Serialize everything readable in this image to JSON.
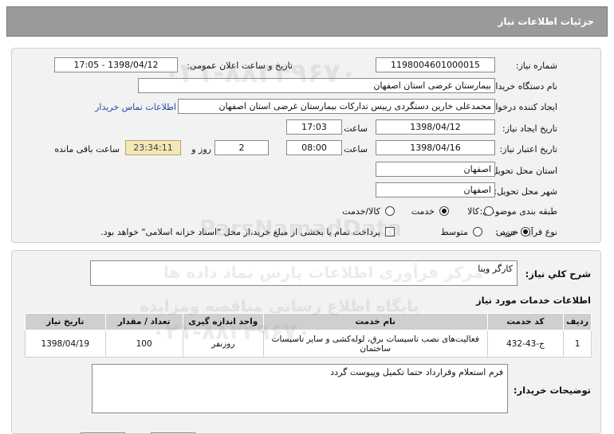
{
  "header": {
    "title": "جزئیات اطلاعات نیاز"
  },
  "fields": {
    "need_number_label": "شماره نیاز:",
    "need_number": "1198004601000015",
    "announce_label": "تاریخ و ساعت اعلان عمومی:",
    "announce_value": "1398/04/12 - 17:05",
    "buyer_org_label": "نام دستگاه خریدار:",
    "buyer_org": "بیمارستان غرضی استان اصفهان",
    "requester_label": "ایجاد کننده درخواست:",
    "requester": "محمدعلی خارین دستگردی رییس تدارکات بیمارستان غرضی استان اصفهان",
    "contact_link": "اطلاعات تماس خریدار",
    "created_label": "تاریخ ایجاد نیاز:",
    "created_date": "1398/04/12",
    "time_label": "ساعت",
    "created_time": "17:03",
    "valid_label": "تاریخ اعتبار نیاز:",
    "valid_date": "1398/04/16",
    "valid_time": "08:00",
    "days": "2",
    "days_label": "روز و",
    "remaining_time": "23:34:11",
    "remaining_label": "ساعت باقی مانده",
    "province_label": "استان محل تحویل:",
    "province": "اصفهان",
    "city_label": "شهر محل تحویل:",
    "city": "اصفهان",
    "category_label": "طبقه بندی موضوعی:",
    "category_options": [
      "کالا",
      "خدمت",
      "کالا/خدمت"
    ],
    "process_label": "نوع فرآیند خرید :",
    "process_options": [
      "جزیی",
      "متوسط"
    ],
    "payment_note": "پرداخت تمام یا بخشی از مبلغ خرید،از محل \"اسناد خزانه اسلامی\" خواهد بود."
  },
  "need_desc": {
    "label": "شرح کلي نیاز:",
    "value": "کارگر وینا"
  },
  "services": {
    "title": "اطلاعات خدمات مورد نیاز",
    "columns": [
      "ردیف",
      "کد خدمت",
      "نام خدمت",
      "واحد اندازه گیری",
      "تعداد / مقدار",
      "تاریخ نیاز"
    ],
    "rows": [
      [
        "1",
        "ج-43-432",
        "فعالیت‌های نصب تاسیسات برق، لوله‌کشی و سایر تاسیسات ساختمان",
        "روزنفر",
        "100",
        "1398/04/19"
      ]
    ]
  },
  "buyer_notes": {
    "label": "توضیحات خریدار:",
    "value": "فرم استعلام وقرارداد حتما تکمیل وپیوست گردد"
  },
  "watermark": {
    "brand": "ParsNamadData",
    "line1": "مرکز فرآوری اطلاعات پارس نماد داده ها",
    "line2": "پایگاه اطلاع رسانی مناقصه ومزایده",
    "phone": "۰۲۱-۸۸۳۴۹۶۷۰"
  }
}
